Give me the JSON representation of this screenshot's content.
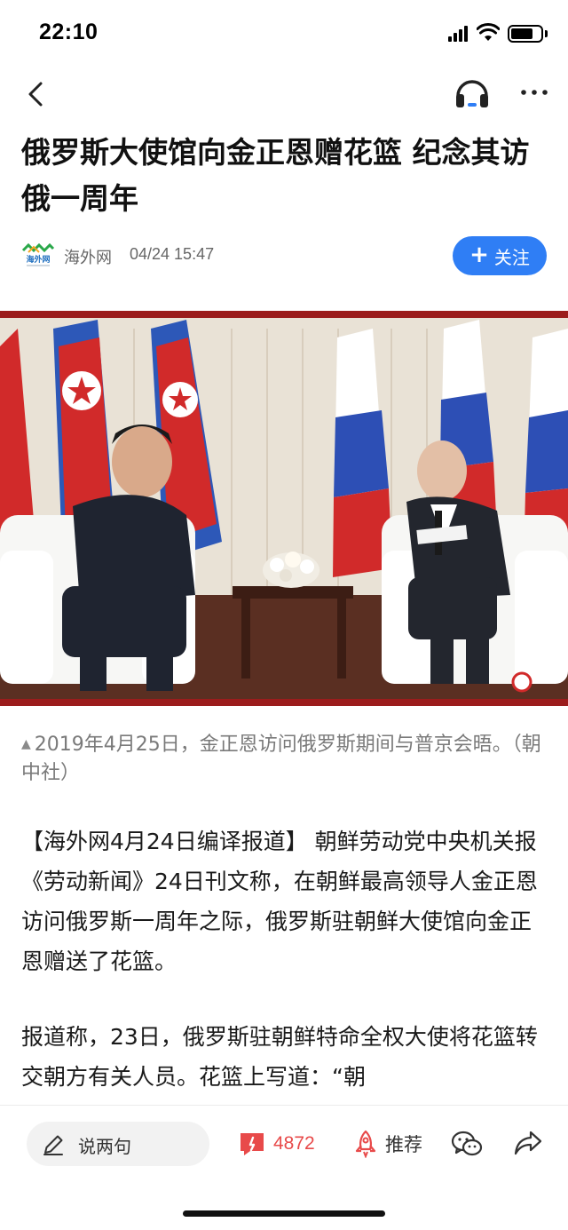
{
  "status_bar": {
    "time": "22:10"
  },
  "nav": {
    "back_icon": "chevron-left-icon",
    "listen_icon": "headphone-icon",
    "more_icon": "more-horizontal-icon"
  },
  "article": {
    "title": "俄罗斯大使馆向金正恩赠花篮 纪念其访俄一周年",
    "source": {
      "logo_icon": "haiwaiwang-logo",
      "name": "海外网",
      "time": "04/24 15:47"
    },
    "follow_label": "关注",
    "photo_alt_icon": "meeting-photo",
    "caption": "2019年4月25日，金正恩访问俄罗斯期间与普京会晤。（朝中社）",
    "paragraphs": [
      "【海外网4月24日编译报道】 朝鲜劳动党中央机关报《劳动新闻》24日刊文称，在朝鲜最高领导人金正恩访问俄罗斯一周年之际，俄罗斯驻朝鲜大使馆向金正恩赠送了花篮。",
      "报道称，23日，俄罗斯驻朝鲜特命全权大使将花篮转交朝方有关人员。花篮上写道：“朝"
    ]
  },
  "bottom_bar": {
    "comment_placeholder": "说两句",
    "comment_count": "4872",
    "recommend_label": "推荐",
    "wechat_icon": "wechat-icon",
    "share_icon": "share-icon"
  },
  "colors": {
    "accent": "#2f7ef5",
    "comment_red": "#e84a4a"
  }
}
